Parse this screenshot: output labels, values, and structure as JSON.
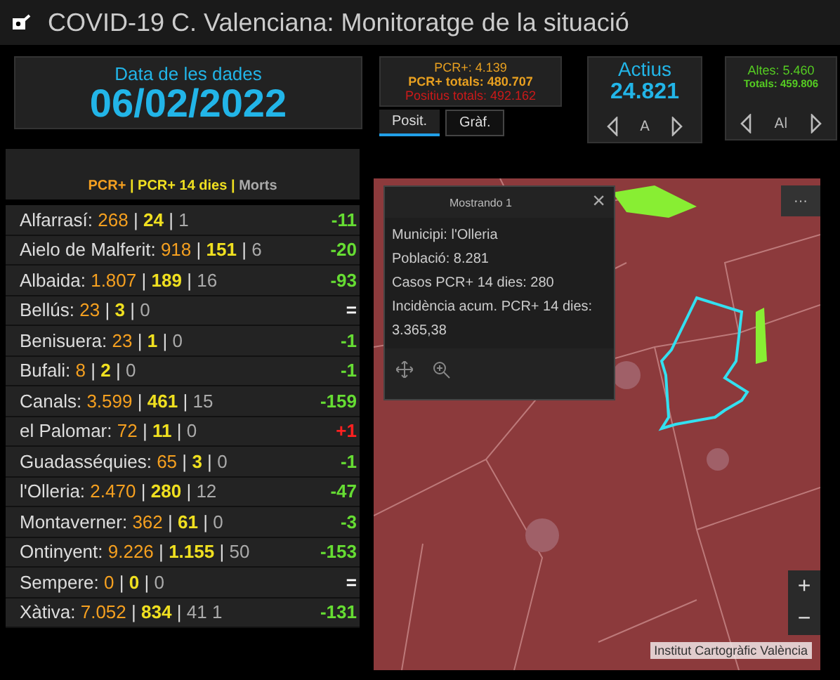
{
  "window": {
    "title": "COVID-19 C. Valenciana: Monitoratge de la situació"
  },
  "date_card": {
    "label": "Data de les dades",
    "date": "06/02/2022"
  },
  "positives_card": {
    "pcr": "PCR+: 4.139",
    "pcr_total": "PCR+ totals: 480.707",
    "positives_total": "Positius totals: 492.162"
  },
  "tabs": [
    {
      "label": "Posit.",
      "selected": true
    },
    {
      "label": "Gràf.",
      "selected": false
    }
  ],
  "active_card": {
    "label": "Actius",
    "value": "24.821",
    "nav_label": "A"
  },
  "discharges_card": {
    "discharges": "Altes: 5.460",
    "total": "Totals: 459.806",
    "nav_label": "Al"
  },
  "list_header": {
    "pcr": "PCR+",
    "pcr14": "PCR+ 14 dies",
    "deaths": "Morts",
    "separator": "|"
  },
  "rows": [
    {
      "name": "Alfarrasí:",
      "pcr": "268",
      "pcr14": "24",
      "deaths": "1",
      "change": "-11",
      "color": "#66dd33"
    },
    {
      "name": "Aielo de Malferit:",
      "pcr": "918",
      "pcr14": "151",
      "deaths": "6",
      "change": "-20",
      "color": "#66dd33"
    },
    {
      "name": "Albaida:",
      "pcr": "1.807",
      "pcr14": "189",
      "deaths": "16",
      "change": "-93",
      "color": "#66dd33"
    },
    {
      "name": "Bellús:",
      "pcr": "23",
      "pcr14": "3",
      "deaths": "0",
      "change": "=",
      "color": "#ffffff"
    },
    {
      "name": "Benisuera:",
      "pcr": "23",
      "pcr14": "1",
      "deaths": "0",
      "change": "-1",
      "color": "#66dd33"
    },
    {
      "name": "Bufali:",
      "pcr": "8",
      "pcr14": "2",
      "deaths": "0",
      "change": "-1",
      "color": "#66dd33"
    },
    {
      "name": "Canals:",
      "pcr": "3.599",
      "pcr14": "461",
      "deaths": "15",
      "change": "-159",
      "color": "#66dd33"
    },
    {
      "name": "el Palomar:",
      "pcr": "72",
      "pcr14": "11",
      "deaths": "0",
      "change": "+1",
      "color": "#ff2020"
    },
    {
      "name": "Guadasséquies:",
      "pcr": "65",
      "pcr14": "3",
      "deaths": "0",
      "change": "-1",
      "color": "#66dd33"
    },
    {
      "name": "l'Olleria:",
      "pcr": "2.470",
      "pcr14": "280",
      "deaths": "12",
      "change": "-47",
      "color": "#66dd33"
    },
    {
      "name": "Montaverner:",
      "pcr": "362",
      "pcr14": "61",
      "deaths": "0",
      "change": "-3",
      "color": "#66dd33"
    },
    {
      "name": "Ontinyent:",
      "pcr": "9.226",
      "pcr14": "1.155",
      "deaths": "50",
      "change": "-153",
      "color": "#66dd33"
    },
    {
      "name": "Sempere:",
      "pcr": "0",
      "pcr14": "0",
      "deaths": "0",
      "change": "=",
      "color": "#ffffff"
    },
    {
      "name": "Xàtiva:",
      "pcr": "7.052",
      "pcr14": "834",
      "deaths": "41 1",
      "change": "-131",
      "color": "#66dd33"
    }
  ],
  "map": {
    "kind": "picture",
    "attribution": "Institut Cartogràfic València",
    "zoom_in": "+",
    "zoom_out": "−",
    "menu": "···"
  },
  "popup": {
    "title": "Mostrando 1",
    "close": "×",
    "lines": [
      "Municipi: l'Olleria",
      "Població: 8.281",
      "Casos PCR+ 14 dies: 280",
      "Incidència acum. PCR+ 14 dies: 3.365,38"
    ]
  }
}
